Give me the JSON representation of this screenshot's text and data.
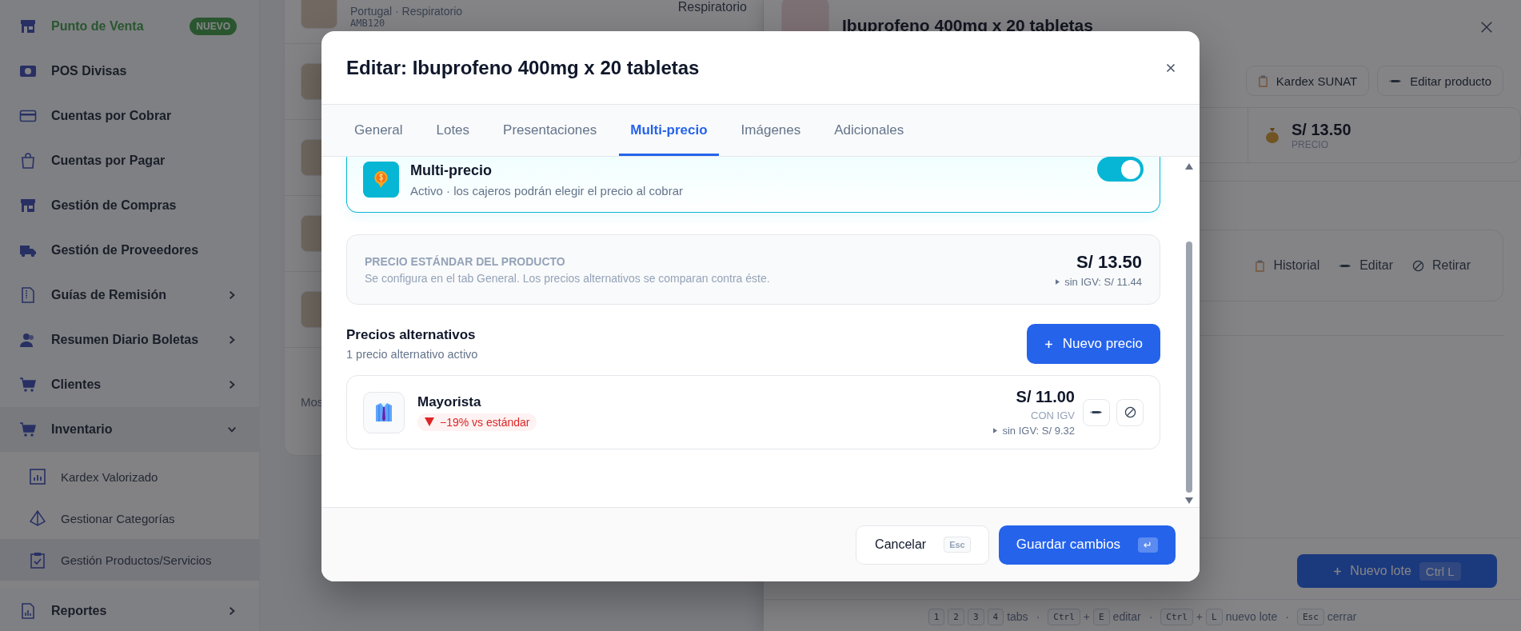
{
  "sidebar": {
    "items": [
      {
        "label": "Punto de Venta",
        "highlighted": true,
        "badge": "NUEVO"
      },
      {
        "label": "POS Divisas",
        "highlighted": false
      },
      {
        "label": "Cuentas por Cobrar",
        "highlighted": false
      },
      {
        "label": "Cuentas por Pagar",
        "highlighted": false
      },
      {
        "label": "Gestión de Compras",
        "highlighted": false
      },
      {
        "label": "Gestión de Proveedores",
        "highlighted": false
      },
      {
        "label": "Guías de Remisión",
        "highlighted": false,
        "expanded": false
      },
      {
        "label": "Resumen Diario Boletas",
        "highlighted": false,
        "expanded": false
      },
      {
        "label": "Clientes",
        "highlighted": false,
        "expanded": false
      },
      {
        "label": "Inventario",
        "highlighted": false,
        "expanded": true,
        "children": [
          {
            "label": "Kardex Valorizado",
            "selected": false
          },
          {
            "label": "Gestionar Categorías",
            "selected": false
          },
          {
            "label": "Gestión Productos/Servicios",
            "selected": true
          }
        ]
      },
      {
        "label": "Reportes",
        "highlighted": false,
        "expanded": false
      }
    ]
  },
  "product_list": {
    "rows": [
      {
        "kind": "text",
        "subtitle": "Portugal · Respiratorio",
        "code": "AMB120",
        "category": "Respiratorio"
      },
      {
        "kind": "thumb"
      },
      {
        "kind": "thumb"
      },
      {
        "kind": "thumb"
      },
      {
        "kind": "thumb"
      }
    ],
    "footer_text": "Mos"
  },
  "detail_panel": {
    "title": "Ibuprofeno 400mg x 20 tabletas",
    "actions": [
      "Kardex SUNAT",
      "Editar producto"
    ],
    "stat": {
      "value": "S/ 13.50",
      "label": "PRECIO"
    },
    "batch_actions": [
      "Historial",
      "Editar",
      "Retirar"
    ],
    "new_batch": {
      "label": "Nuevo lote",
      "shortcut": "Ctrl L"
    },
    "separator": "·",
    "shortcuts": [
      {
        "keys": [
          "1",
          "2",
          "3",
          "4"
        ],
        "label": "tabs"
      },
      {
        "keys": [
          "Ctrl",
          "E"
        ],
        "joiner": "+",
        "label": "editar"
      },
      {
        "keys": [
          "Ctrl",
          "L"
        ],
        "joiner": "+",
        "label": "nuevo lote"
      },
      {
        "keys": [
          "Esc"
        ],
        "label": "cerrar"
      }
    ]
  },
  "modal": {
    "title": "Editar: Ibuprofeno 400mg x 20 tabletas",
    "tabs": [
      {
        "label": "General",
        "selected": false
      },
      {
        "label": "Lotes",
        "selected": false
      },
      {
        "label": "Presentaciones",
        "selected": false
      },
      {
        "label": "Multi-precio",
        "selected": true
      },
      {
        "label": "Imágenes",
        "selected": false
      },
      {
        "label": "Adicionales",
        "selected": false
      }
    ],
    "multi_price": {
      "title": "Multi-precio",
      "description": "Activo · los cajeros podrán elegir el precio al cobrar",
      "enabled": true
    },
    "standard_price": {
      "label": "PRECIO ESTÁNDAR DEL PRODUCTO",
      "description": "Se configura en el tab General. Los precios alternativos se comparan contra éste.",
      "price": "S/ 13.50",
      "net": "sin IGV: S/ 11.44"
    },
    "alternatives": {
      "title": "Precios alternativos",
      "subtitle": "1 precio alternativo activo",
      "add_button": "Nuevo precio",
      "items": [
        {
          "name": "Mayorista",
          "difference": "−19% vs estándar",
          "kind": "decrease",
          "price": "S/ 11.00",
          "tax_note": "CON IGV",
          "net": "sin IGV: S/ 9.32"
        }
      ]
    },
    "footer": {
      "cancel": "Cancelar",
      "cancel_key": "Esc",
      "save": "Guardar cambios",
      "save_key": "↵"
    }
  }
}
